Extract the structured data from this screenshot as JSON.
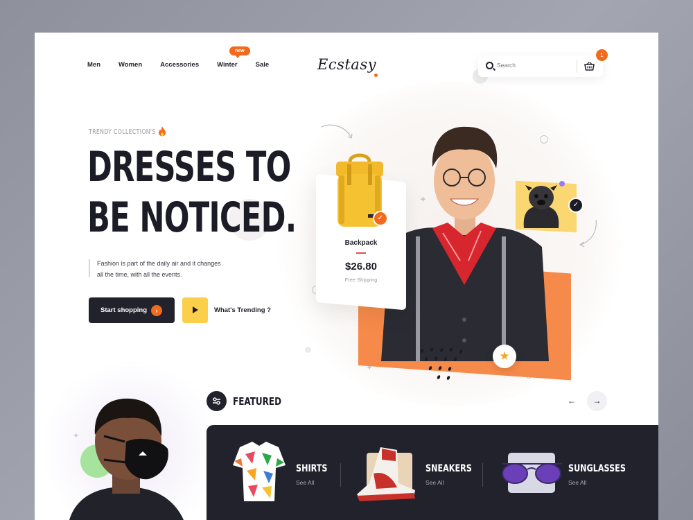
{
  "nav": {
    "items": [
      "Men",
      "Women",
      "Accessories",
      "Winter",
      "Sale"
    ],
    "new_badge": "new"
  },
  "logo": "Ecstasy",
  "search": {
    "placeholder": "Search"
  },
  "cart": {
    "count": "1"
  },
  "hero": {
    "eyebrow": "TRENDY COLLECTION'S",
    "headline_line1": "DRESSES TO",
    "headline_line2": "BE NOTICED.",
    "desc_line1": "Fashion is part of the daily air and it changes",
    "desc_line2": "all the time, with all the events.",
    "start_button": "Start shopping",
    "trending_link": "What's Trending ?"
  },
  "product_card": {
    "name": "Backpack",
    "price": "$26.80",
    "shipping": "Free Shipping"
  },
  "featured": {
    "title": "FEATURED",
    "categories": [
      {
        "name": "SHIRTS",
        "link": "See All"
      },
      {
        "name": "SNEAKERS",
        "link": "See All"
      },
      {
        "name": "SUNGLASSES",
        "link": "See All"
      }
    ]
  },
  "colors": {
    "accent": "#f26a1b",
    "dark": "#22222d",
    "yellow": "#fbcf4a",
    "orange_block": "#f68a4a"
  },
  "icons": [
    "search-icon",
    "basket-icon",
    "fire-icon",
    "arrow-right-icon",
    "play-icon",
    "check-icon",
    "star-icon",
    "filter-icon",
    "arrow-left-icon"
  ]
}
